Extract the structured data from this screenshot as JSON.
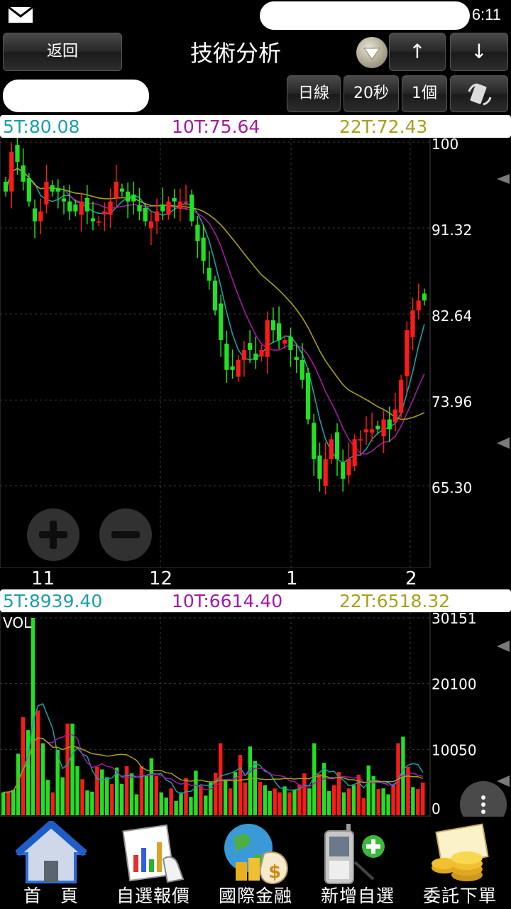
{
  "status": {
    "time": "6:11"
  },
  "toolbar": {
    "back_label": "返回",
    "title": "技術分析",
    "up_label": "↑",
    "down_label": "↓",
    "period_label": "日線",
    "interval_label": "20秒",
    "count_label": "1個"
  },
  "price_panel": {
    "ma5": "5T:80.08",
    "ma10": "10T:75.64",
    "ma22": "22T:72.43",
    "y_ticks": [
      "100",
      "91.32",
      "82.64",
      "73.96",
      "65.30"
    ],
    "x_ticks": [
      "11",
      "12",
      "1",
      "2"
    ]
  },
  "volume_panel": {
    "ma5": "5T:8939.40",
    "ma10": "10T:6614.40",
    "ma22": "22T:6518.32",
    "label": "VOL",
    "y_ticks": [
      "30151",
      "20100",
      "10050",
      "0"
    ]
  },
  "nav": [
    {
      "label": "首　頁",
      "icon": "home-icon"
    },
    {
      "label": "自選報價",
      "icon": "chart-report-icon"
    },
    {
      "label": "國際金融",
      "icon": "globe-finance-icon"
    },
    {
      "label": "新增自選",
      "icon": "phone-add-icon"
    },
    {
      "label": "委託下單",
      "icon": "order-coins-icon"
    }
  ],
  "colors": {
    "up": "#ff1a1a",
    "down": "#22e022",
    "ma5": "#18a0a8",
    "ma10": "#a418a8",
    "ma22": "#a8a018"
  },
  "chart_data": [
    {
      "type": "candlestick",
      "title": "",
      "ylim": [
        65.3,
        100
      ],
      "y_ticks": [
        100,
        91.32,
        82.64,
        73.96,
        65.3
      ],
      "x_tick_labels": [
        "11",
        "12",
        "1",
        "2"
      ],
      "series": [
        {
          "name": "5T",
          "last": 80.08
        },
        {
          "name": "10T",
          "last": 75.64
        },
        {
          "name": "22T",
          "last": 72.43
        }
      ],
      "close": [
        95,
        99,
        98,
        96,
        94,
        92,
        93,
        96,
        95,
        95,
        94,
        93,
        93,
        94,
        93,
        92,
        92,
        93,
        94,
        96,
        95,
        94,
        94,
        93,
        92,
        92,
        93,
        93,
        94,
        94,
        94,
        94,
        92,
        90,
        88,
        86,
        83,
        80,
        77,
        77,
        78,
        79,
        79,
        78,
        79,
        82,
        81,
        80,
        80,
        79,
        78,
        76,
        72,
        68,
        66,
        68,
        70,
        68,
        66,
        68,
        70,
        70,
        71,
        71,
        71,
        72,
        71,
        73,
        76,
        81,
        83,
        84,
        84
      ]
    },
    {
      "type": "bar",
      "title": "",
      "ylim": [
        0,
        30151
      ],
      "y_ticks": [
        0,
        10050,
        20100,
        30151
      ],
      "series": [
        {
          "name": "5T",
          "last": 8939.4
        },
        {
          "name": "10T",
          "last": 6614.4
        },
        {
          "name": "22T",
          "last": 6518.32
        }
      ],
      "values": [
        3500,
        3600,
        3900,
        9400,
        15000,
        13000,
        30151,
        16000,
        11000,
        5400,
        3500,
        10000,
        5800,
        14000,
        14000,
        7500,
        5500,
        3800,
        3600,
        7400,
        7000,
        5800,
        4800,
        7300,
        4800,
        7500,
        6400,
        3200,
        7500,
        6000,
        8700,
        6000,
        3500,
        2700,
        4100,
        2200,
        3500,
        5700,
        2800,
        6800,
        4500,
        3000,
        5000,
        6500,
        11000,
        5500,
        4100,
        6600,
        9200,
        5000,
        10500,
        8300,
        5100,
        4600,
        3700,
        4100,
        3500,
        4400,
        3500,
        3900,
        4700,
        6400,
        4100,
        11000,
        6300,
        8000,
        3700,
        4600,
        6600,
        3500,
        4100,
        4600,
        6200,
        2600,
        7600,
        6000,
        4000,
        4100,
        3200,
        4700,
        11000,
        12000,
        7400,
        4300,
        4000,
        5000
      ]
    }
  ]
}
